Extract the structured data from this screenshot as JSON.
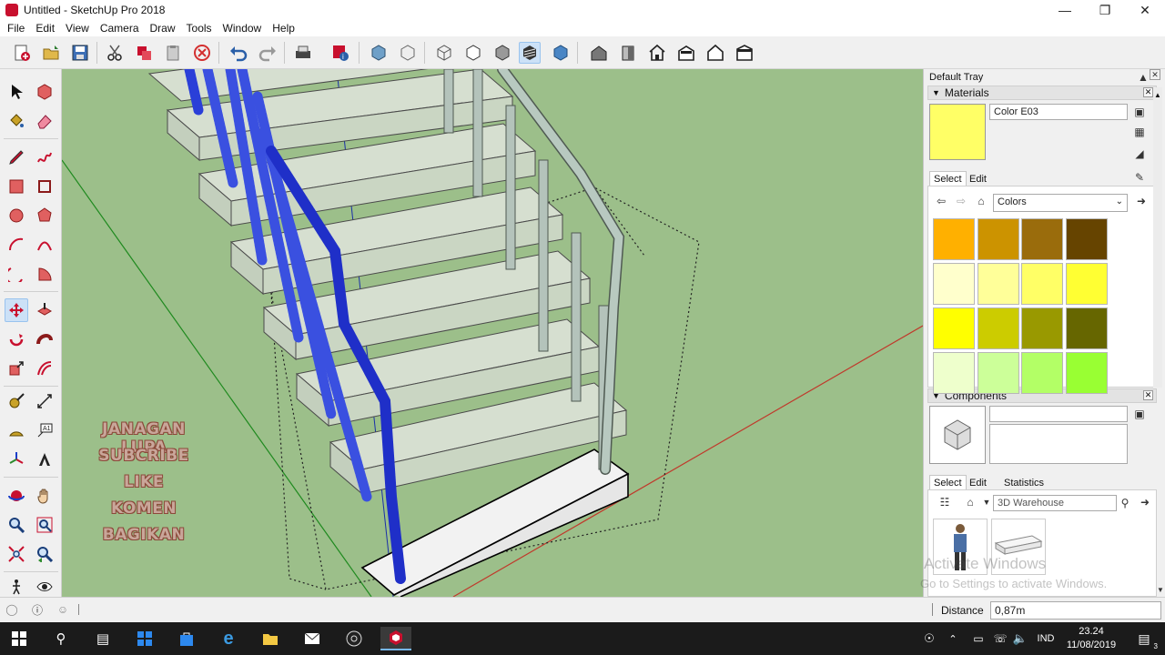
{
  "window": {
    "title": "Untitled - SketchUp Pro 2018"
  },
  "menu": [
    "File",
    "Edit",
    "View",
    "Camera",
    "Draw",
    "Tools",
    "Window",
    "Help"
  ],
  "overlay_text": [
    "JANAGAN LUPA",
    "SUBCRIBE",
    "LIKE",
    "KOMEN",
    "BAGIKAN"
  ],
  "tray": {
    "title": "Default Tray",
    "materials": {
      "header": "Materials",
      "current_name": "Color E03",
      "current_color": "#ffff66",
      "tabs": [
        "Select",
        "Edit"
      ],
      "library": "Colors",
      "swatches": [
        [
          "#ffb000",
          "#cc9300",
          "#9a6c0c",
          "#664400"
        ],
        [
          "#ffffcc",
          "#ffff99",
          "#ffff66",
          "#ffff33"
        ],
        [
          "#ffff00",
          "#cccc00",
          "#999900",
          "#666600"
        ],
        [
          "#eeffcc",
          "#ccff99",
          "#b3ff66",
          "#99ff33"
        ]
      ]
    },
    "components": {
      "header": "Components",
      "tabs": [
        "Select",
        "Edit",
        "Statistics"
      ],
      "search_placeholder": "3D Warehouse"
    }
  },
  "watermark": {
    "line1": "Activate Windows",
    "line2": "Go to Settings to activate Windows."
  },
  "status": {
    "measure_label": "Distance",
    "measure_value": "0,87m"
  },
  "taskbar": {
    "language": "IND",
    "time": "23.24",
    "date": "11/08/2019",
    "notification_count": "3"
  }
}
